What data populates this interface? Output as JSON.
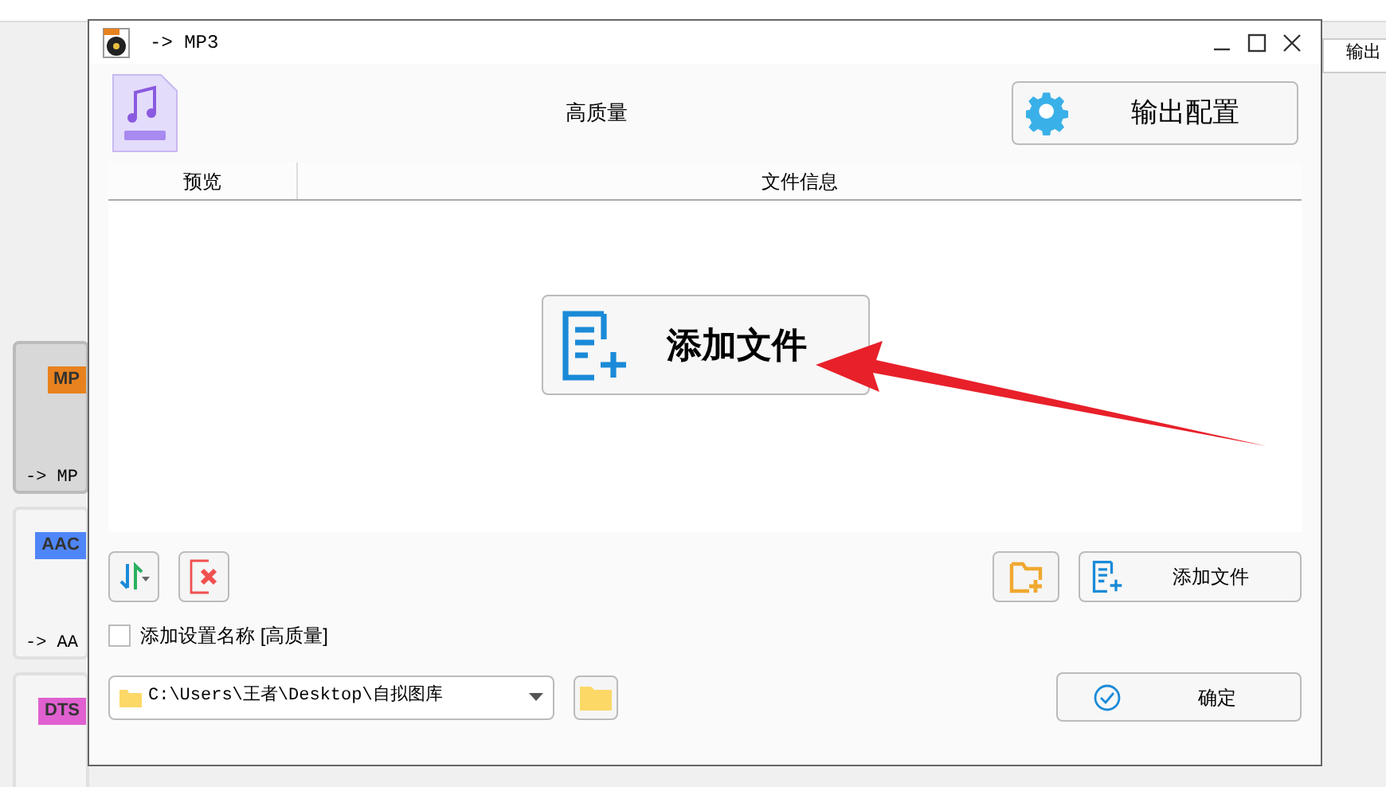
{
  "background": {
    "right_tab": "输出",
    "tiles": [
      {
        "badge": "MP",
        "label": "-> MP",
        "color": "#e8821e",
        "selected": true
      },
      {
        "badge": "AAC",
        "label": "-> AA",
        "color": "#4f86f7",
        "selected": false
      },
      {
        "badge": "DTS",
        "color": "#e060d0",
        "selected": false
      }
    ]
  },
  "dialog": {
    "title": "-> MP3",
    "preset": "高质量",
    "output_button": "输出配置",
    "table": {
      "columns": [
        "预览",
        "文件信息"
      ]
    },
    "add_file_big": "添加文件",
    "add_file": "添加文件",
    "checkbox": {
      "label": "添加设置名称 [高质量]",
      "checked": false
    },
    "path": "C:\\Users\\王者\\Desktop\\自拟图库",
    "ok": "确定"
  }
}
